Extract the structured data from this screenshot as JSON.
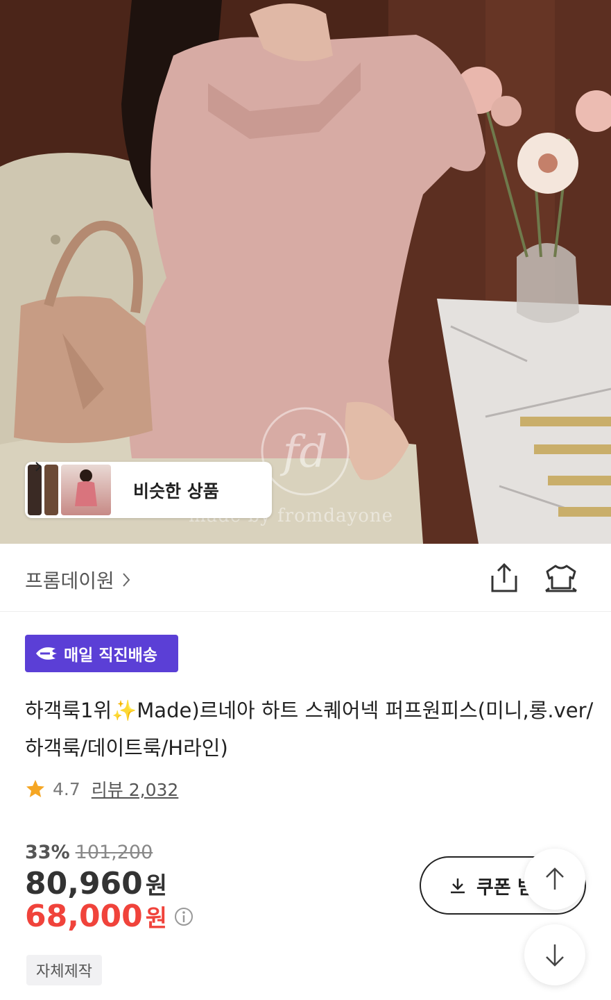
{
  "hero": {
    "watermark": "made by fromdayone",
    "logo_text": "fd",
    "similar_products_label": "비슷한 상품"
  },
  "brand": {
    "name": "프롬데이원"
  },
  "badge": {
    "label": "매일 직진배송",
    "color": "#5b3fd6"
  },
  "product": {
    "title": "하객룩1위✨Made)르네아 하트 스퀘어넥 퍼프원피스(미니,롱.ver/하객룩/데이트룩/H라인)",
    "rating": "4.7",
    "review_label": "리뷰 2,032"
  },
  "price": {
    "discount_rate": "33%",
    "original_price": "101,200",
    "sale_price": "80,960",
    "final_price": "68,000",
    "currency": "원",
    "final_color": "#f0433b"
  },
  "tag": {
    "label": "자체제작"
  },
  "coupon": {
    "label": "쿠폰 받기"
  },
  "icons": {
    "share": "share-icon",
    "compare": "hanger-icon",
    "scroll_up": "arrow-up-icon",
    "scroll_down": "arrow-down-icon",
    "download": "download-icon",
    "star": "star-icon",
    "info": "info-icon",
    "chevron": "chevron-right-icon"
  }
}
